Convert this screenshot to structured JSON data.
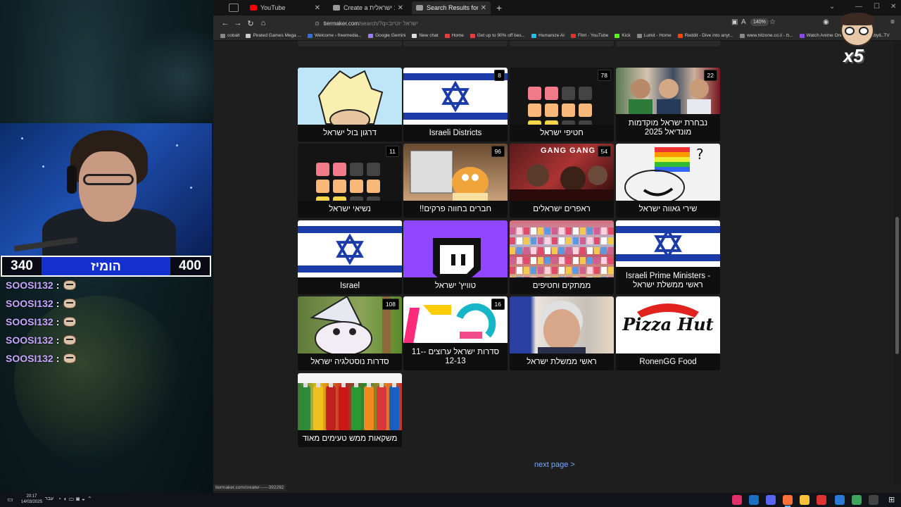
{
  "stream": {
    "score_left": "340",
    "score_label": "הומיז",
    "score_right": "400",
    "chat": [
      {
        "user": "SOOSI132"
      },
      {
        "user": "SOOSI132"
      },
      {
        "user": "SOOSI132"
      },
      {
        "user": "SOOSI132"
      },
      {
        "user": "SOOSI132"
      }
    ],
    "chat_separator": ":",
    "emote_multiplier": "x5"
  },
  "browser": {
    "tabs": [
      {
        "title": "YouTube",
        "fav_color": "#ff0000",
        "active": false
      },
      {
        "title": "Create a יוצרת קלות ישראלית...",
        "fav_color": "#9a9a9a",
        "active": false
      },
      {
        "title": "Search Results for \"ישראל\" יוטיוב",
        "fav_color": "#9a9a9a",
        "active": true
      }
    ],
    "new_tab": "+",
    "url_host": "tiermaker.com",
    "url_path": "/search/?q=ישראל יוטיוב",
    "zoom": "140%",
    "bookmarks": [
      {
        "label": "cobalt",
        "color": "#888888"
      },
      {
        "label": "Pirated Games Mega ...",
        "color": "#cccccc"
      },
      {
        "label": "Welcome › freemedia...",
        "color": "#3a6ae0"
      },
      {
        "label": "Google Gemini",
        "color": "#9a7aff"
      },
      {
        "label": "New chat",
        "color": "#dddddd"
      },
      {
        "label": "Home",
        "color": "#e04040"
      },
      {
        "label": "Get up to 90% off bes...",
        "color": "#e04040"
      },
      {
        "label": "Humanize AI",
        "color": "#20c0e0"
      },
      {
        "label": "Flint - YouTube",
        "color": "#e03030"
      },
      {
        "label": "Kick",
        "color": "#53fc18"
      },
      {
        "label": "Lurkit - Home",
        "color": "#888888"
      },
      {
        "label": "Reddit - Dive into anyt...",
        "color": "#ff4500"
      },
      {
        "label": "www.hitzone.co.il - מ...",
        "color": "#888888"
      },
      {
        "label": "Watch Anime Online, ...",
        "color": "#8a4ae0"
      },
      {
        "label": "embyIL.TV",
        "color": "#52b54b"
      }
    ],
    "status_url": "tiermaker.com/create/------392292",
    "next_page": "next page >"
  },
  "results": [
    {
      "title": "דרגון בול ישראל",
      "badge": "",
      "thumb": "dragon"
    },
    {
      "title": "Israeli Districts",
      "badge": "8",
      "thumb": "israel"
    },
    {
      "title": "חטיפי ישראל",
      "badge": "78",
      "thumb": "tiles"
    },
    {
      "title": "נבחרת ישראל מוקדמות מונדיאל 2025",
      "badge": "22",
      "thumb": "photos"
    },
    {
      "title": "נשיאי ישראל",
      "badge": "11",
      "thumb": "tiles"
    },
    {
      "title": "חברים בחווה פרקים!!",
      "badge": "96",
      "thumb": "rayman"
    },
    {
      "title": "ראפרים ישראלים",
      "badge": "54",
      "thumb": "rappers",
      "thumb_text": "GANG GANG"
    },
    {
      "title": "שירי גאווה ישראל",
      "badge": "",
      "thumb": "meme"
    },
    {
      "title": "Israel",
      "badge": "",
      "thumb": "israel"
    },
    {
      "title": "טוויץ' ישראל",
      "badge": "",
      "thumb": "twitch"
    },
    {
      "title": "ממתקים וחטיפים",
      "badge": "",
      "thumb": "market"
    },
    {
      "title": "Israeli Prime Ministers - ראשי ממשלת ישראל",
      "badge": "",
      "thumb": "israel"
    },
    {
      "title": "סדרות נוסטלגיה ישראל",
      "badge": "108",
      "thumb": "wizard"
    },
    {
      "title": "סדרות ישראל ערוצים -11-12-13",
      "badge": "16",
      "thumb": "logo"
    },
    {
      "title": "ראשי ממשלת ישראל",
      "badge": "",
      "thumb": "pm"
    },
    {
      "title": "RonenGG Food",
      "badge": "",
      "thumb": "pizza",
      "thumb_text": "Pizza Hut"
    },
    {
      "title": "משקאות ממש טעימים מאוד",
      "badge": "",
      "thumb": "drinks"
    }
  ],
  "taskbar": {
    "time": "20:17",
    "date": "14/03/2025",
    "lang": "עבר"
  },
  "colors": {
    "browser_bg": "#1e1e1e",
    "link": "#7aa7ff",
    "score_bar": "#1530d0",
    "chat_name": "#c9a7ff"
  }
}
